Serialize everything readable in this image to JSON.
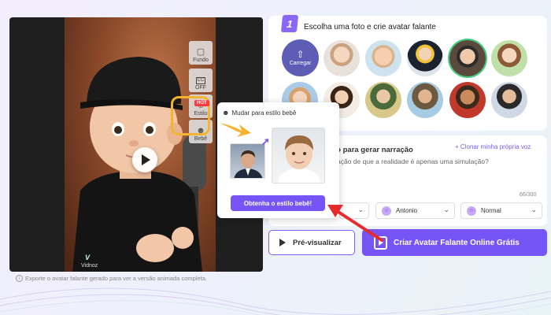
{
  "preview": {
    "watermark": "Vidnoz",
    "tools": [
      {
        "label": "Fundo",
        "icon": "background-icon"
      },
      {
        "label": "OFF",
        "icon": "cc-icon",
        "badge": "CC"
      },
      {
        "label": "Estilo",
        "icon": "style-icon"
      },
      {
        "label": "Bebê",
        "icon": "baby-icon",
        "tag": "HOT"
      }
    ]
  },
  "popup": {
    "title": "Mudar para estilo bebê",
    "button": "Obtenha o estilo bebê!"
  },
  "step1": {
    "number": "1",
    "title": "Escolha uma foto e crie avatar falante",
    "upload_label": "Carregar"
  },
  "narration": {
    "title": "to para gerar narração",
    "clone_link": "+ Clonar minha própria voz",
    "text": "ação de que a realidade é apenas uma simulação?",
    "char_count": "66/300",
    "voice": "Antonio",
    "emotion": "Normal"
  },
  "actions": {
    "preview": "Pré-visualizar",
    "create": "Criar Avatar Falante Online Grátis"
  },
  "footnote": "Exporte o avatar falante gerado para ver a versão animada completa.",
  "colors": {
    "accent": "#7654f5",
    "highlight": "#f3b431",
    "arrow": "#e52b2b",
    "selected_ring": "#3fcf7b"
  }
}
